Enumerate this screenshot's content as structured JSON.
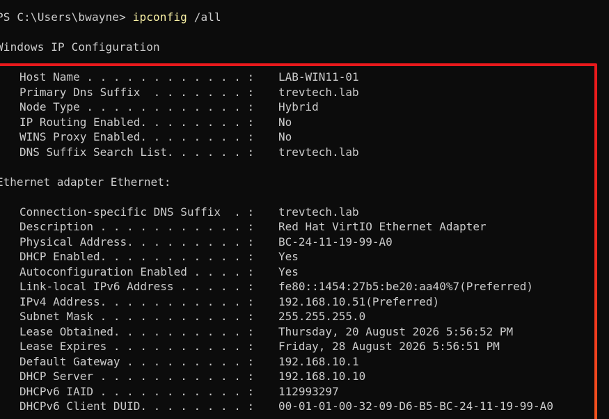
{
  "prompt": {
    "text": "PS C:\\Users\\bwayne> ",
    "command": "ipconfig",
    "args": " /all"
  },
  "heading": "Windows IP Configuration",
  "global_config": [
    {
      "label": "Host Name . . . . . . . . . . . . :",
      "value": "LAB-WIN11-01"
    },
    {
      "label": "Primary Dns Suffix  . . . . . . . :",
      "value": "trevtech.lab"
    },
    {
      "label": "Node Type . . . . . . . . . . . . :",
      "value": "Hybrid"
    },
    {
      "label": "IP Routing Enabled. . . . . . . . :",
      "value": "No"
    },
    {
      "label": "WINS Proxy Enabled. . . . . . . . :",
      "value": "No"
    },
    {
      "label": "DNS Suffix Search List. . . . . . :",
      "value": "trevtech.lab"
    }
  ],
  "adapter_heading": "Ethernet adapter Ethernet:",
  "adapter_config": [
    {
      "label": "Connection-specific DNS Suffix  . :",
      "value": "trevtech.lab"
    },
    {
      "label": "Description . . . . . . . . . . . :",
      "value": "Red Hat VirtIO Ethernet Adapter"
    },
    {
      "label": "Physical Address. . . . . . . . . :",
      "value": "BC-24-11-19-99-A0"
    },
    {
      "label": "DHCP Enabled. . . . . . . . . . . :",
      "value": "Yes"
    },
    {
      "label": "Autoconfiguration Enabled . . . . :",
      "value": "Yes"
    },
    {
      "label": "Link-local IPv6 Address . . . . . :",
      "value": "fe80::1454:27b5:be20:aa40%7(Preferred)"
    },
    {
      "label": "IPv4 Address. . . . . . . . . . . :",
      "value": "192.168.10.51(Preferred)"
    },
    {
      "label": "Subnet Mask . . . . . . . . . . . :",
      "value": "255.255.255.0"
    },
    {
      "label": "Lease Obtained. . . . . . . . . . :",
      "value": "Thursday, 20 August 2026 5:56:52 PM"
    },
    {
      "label": "Lease Expires . . . . . . . . . . :",
      "value": "Friday, 28 August 2026 5:56:51 PM"
    },
    {
      "label": "Default Gateway . . . . . . . . . :",
      "value": "192.168.10.1"
    },
    {
      "label": "DHCP Server . . . . . . . . . . . :",
      "value": "192.168.10.10"
    },
    {
      "label": "DHCPv6 IAID . . . . . . . . . . . :",
      "value": "112993297"
    },
    {
      "label": "DHCPv6 Client DUID. . . . . . . . :",
      "value": "00-01-01-00-32-09-D6-B5-BC-24-11-19-99-A0"
    }
  ],
  "colors": {
    "background": "#0c0c0c",
    "text": "#cccccc",
    "command": "#f9f1a5",
    "highlight_border": "#e8191c"
  }
}
